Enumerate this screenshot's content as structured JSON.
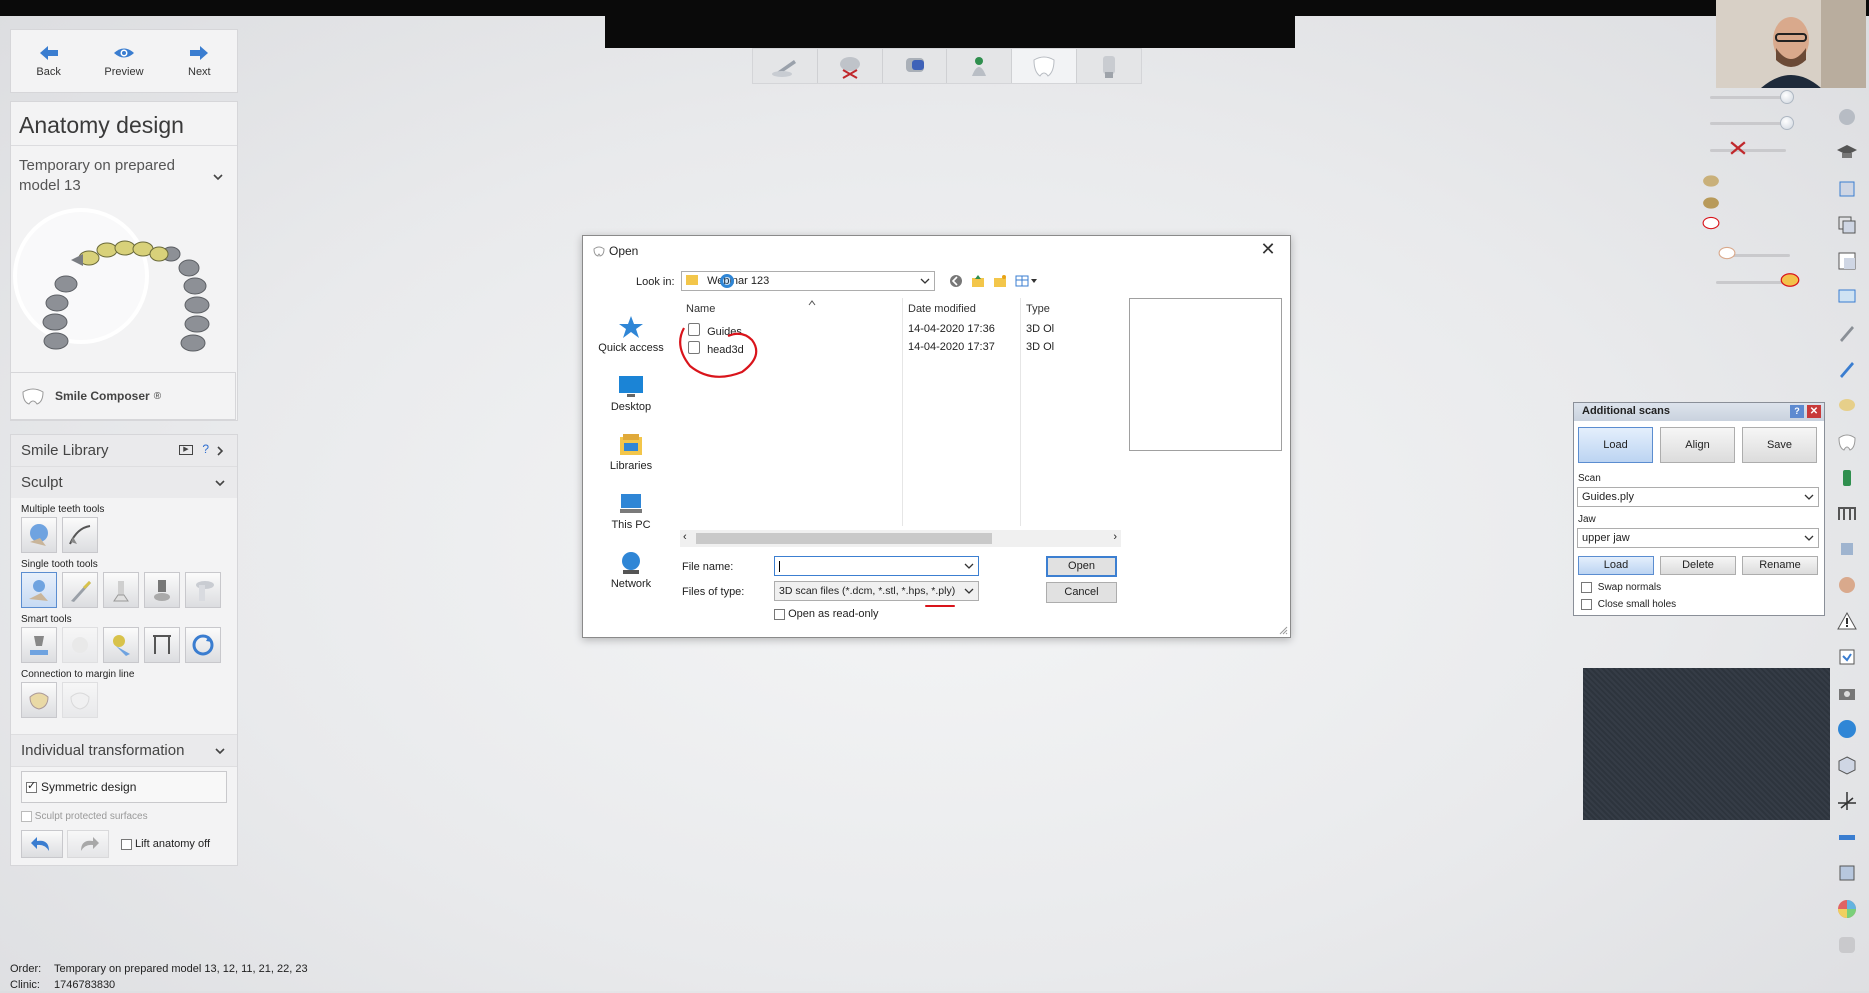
{
  "nav": {
    "back_label": "Back",
    "preview_label": "Preview",
    "next_label": "Next"
  },
  "left_panel": {
    "title": "Anatomy design",
    "model_label": "Temporary on prepared model 13",
    "smile_composer_label": "Smile Composer",
    "smile_composer_mark": "®",
    "smile_library_label": "Smile Library",
    "smile_library_help": "?",
    "sculpt_label": "Sculpt",
    "multiple_teeth_tools_label": "Multiple teeth tools",
    "single_tooth_tools_label": "Single tooth tools",
    "smart_tools_label": "Smart tools",
    "connection_label": "Connection to margin line",
    "individual_transformation_label": "Individual transformation",
    "symmetric_design_label": "Symmetric design",
    "symmetric_design_checked": true,
    "sculpt_protected_label": "Sculpt protected surfaces",
    "lift_anatomy_label": "Lift anatomy off"
  },
  "status": {
    "order_key": "Order:",
    "order_value": "Temporary on prepared model 13, 12, 11, 21, 22, 23",
    "clinic_key": "Clinic:",
    "clinic_value": "1746783830"
  },
  "dialog": {
    "title": "Open",
    "close_glyph": "✕",
    "look_in_label": "Look in:",
    "look_in_value": "Webinar 123",
    "quick_access": [
      "Quick access",
      "Desktop",
      "Libraries",
      "This PC",
      "Network"
    ],
    "columns": {
      "name": "Name",
      "date": "Date modified",
      "type": "Type"
    },
    "files": [
      {
        "name": "Guides",
        "date": "14-04-2020 17:36",
        "type": "3D Ol"
      },
      {
        "name": "head3d",
        "date": "14-04-2020 17:37",
        "type": "3D Ol"
      }
    ],
    "file_name_label": "File name:",
    "file_name_value": "",
    "files_of_type_label": "Files of type:",
    "files_of_type_value": "3D scan files (*.dcm, *.stl, *.hps, *.ply)",
    "read_only_label": "Open as read-only",
    "open_button": "Open",
    "cancel_button": "Cancel"
  },
  "additional_scans": {
    "title": "Additional scans",
    "help": "?",
    "close": "✕",
    "tabs": [
      "Load",
      "Align",
      "Save"
    ],
    "scan_label": "Scan",
    "scan_value": "Guides.ply",
    "jaw_label": "Jaw",
    "jaw_value": "upper jaw",
    "buttons": [
      "Load",
      "Delete",
      "Rename"
    ],
    "swap_normals_label": "Swap normals",
    "close_small_holes_label": "Close small holes"
  },
  "colors": {
    "accent_blue": "#3c7fd1",
    "annotation_red": "#d9141b",
    "background": "#e9eaec"
  }
}
